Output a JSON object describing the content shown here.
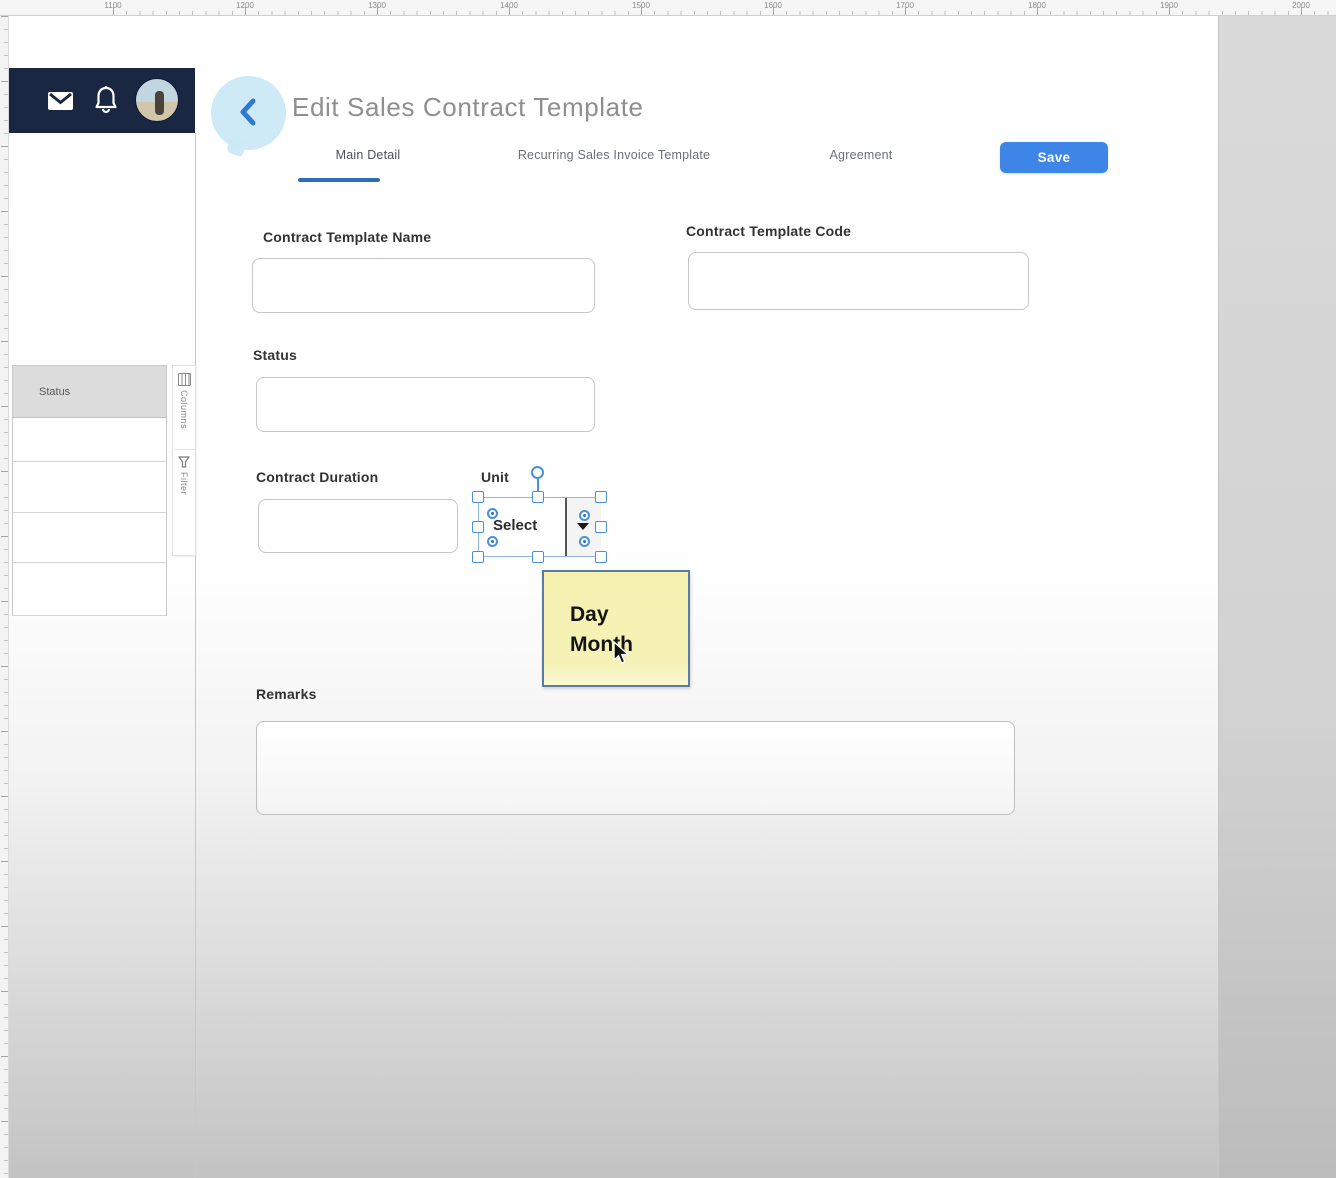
{
  "ruler": {
    "numbers": [
      "1100",
      "1200",
      "1300",
      "1400",
      "1500",
      "1600",
      "1700",
      "1800",
      "1900",
      "2000"
    ]
  },
  "header": {
    "icons": {
      "mail": "mail-icon",
      "bell": "bell-icon",
      "avatar": "user-avatar"
    }
  },
  "page": {
    "title": "Edit Sales Contract Template",
    "back_icon": "chevron-left-icon"
  },
  "tabs": [
    {
      "label": "Main Detail",
      "active": true
    },
    {
      "label": "Recurring Sales Invoice Template",
      "active": false
    },
    {
      "label": "Agreement",
      "active": false
    }
  ],
  "actions": {
    "save": "Save"
  },
  "form": {
    "contract_template_name": {
      "label": "Contract Template Name",
      "value": ""
    },
    "contract_template_code": {
      "label": "Contract Template Code",
      "value": ""
    },
    "status": {
      "label": "Status",
      "value": ""
    },
    "contract_duration": {
      "label": "Contract Duration",
      "value": ""
    },
    "unit": {
      "label": "Unit",
      "select_placeholder": "Select",
      "dropdown_icon": "caret-down-icon"
    },
    "remarks": {
      "label": "Remarks",
      "value": ""
    }
  },
  "dropdown_note": {
    "options": [
      "Day",
      "Month"
    ]
  },
  "left_panel": {
    "column_header": "Status",
    "row_count": 4,
    "tools": [
      {
        "icon": "columns-icon",
        "label": "Columns"
      },
      {
        "icon": "filter-icon",
        "label": "Filter"
      }
    ]
  },
  "colors": {
    "accent_blue": "#3d86e8",
    "selection_blue": "#4a90d9",
    "tab_underline": "#2e6db6",
    "note_yellow": "#f6f2b6",
    "note_border": "#5d7b9c",
    "header_navy": "#1a2742"
  }
}
